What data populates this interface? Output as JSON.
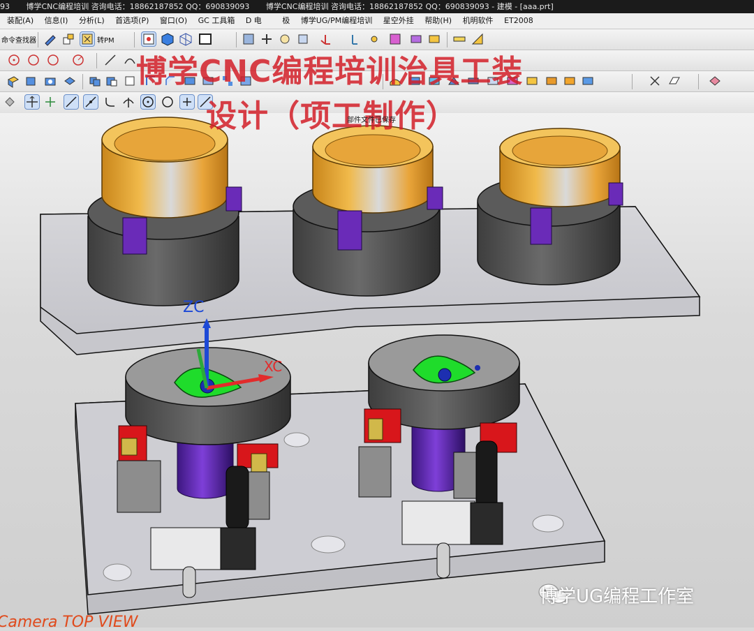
{
  "titlebar": {
    "segments": [
      "93",
      "博学CNC编程培训 咨询电话：18862187852  QQ：690839093",
      "博学CNC编程培训 咨询电话：18862187852  QQ：690839093 - 建模 - [aaa.prt]"
    ]
  },
  "menubar": {
    "items": [
      "装配(A)",
      "信息(I)",
      "分析(L)",
      "首选项(P)",
      "窗口(O)",
      "GC 工具箱",
      "D 电",
      "极",
      "博学UG/PM编程培训",
      "星空外挂",
      "帮助(H)",
      "机明软件",
      "ET2008"
    ]
  },
  "toolbar": {
    "command_finder_label": "命令查找器",
    "convert_label": "转PM"
  },
  "overlay": {
    "line1": "博学CNC编程培训治具工装",
    "line2": "设计（项工制作）"
  },
  "viewport": {
    "save_hint": "部件文件已保存",
    "axis_zc": "ZC",
    "axis_xc": "XC",
    "view_name": "Camera  TOP VIEW",
    "watermark": "博学UG编程工作室"
  },
  "colors": {
    "gold_ring": "#e8a227",
    "body_gray": "#5b5b5b",
    "purple": "#6a2bb8",
    "green_jaw": "#1fdc2b",
    "red_block": "#d8161b",
    "overlay_red": "#d21e28",
    "plate": "#cfcfd4"
  }
}
